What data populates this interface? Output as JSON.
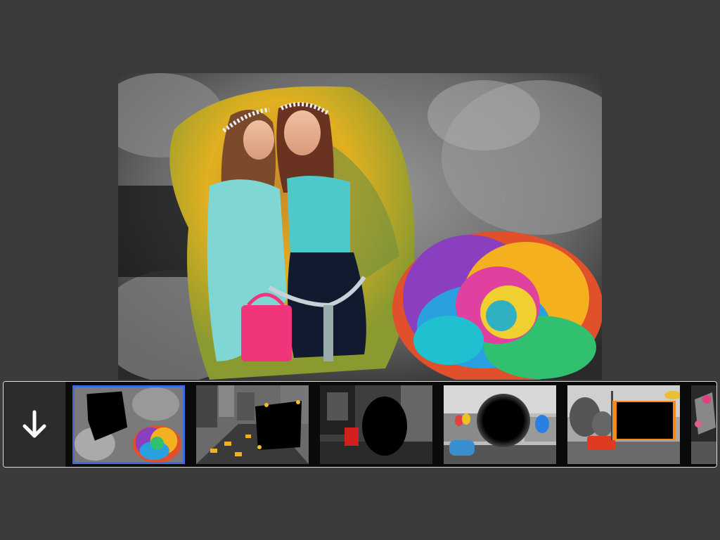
{
  "app": {
    "accent_color": "#3f6be0",
    "background_color": "#3b3b3b"
  },
  "editor": {
    "preview_description_icon": "photo-preview",
    "download_button_icon": "down-arrow-icon"
  },
  "frames": {
    "items": [
      {
        "id": "frame-rose",
        "selected": true
      },
      {
        "id": "frame-city-taxi",
        "selected": false
      },
      {
        "id": "frame-city-night-oval",
        "selected": false
      },
      {
        "id": "frame-colosseum-circle",
        "selected": false
      },
      {
        "id": "frame-street-red-car",
        "selected": false
      },
      {
        "id": "frame-flowers-partial",
        "selected": false
      }
    ]
  }
}
